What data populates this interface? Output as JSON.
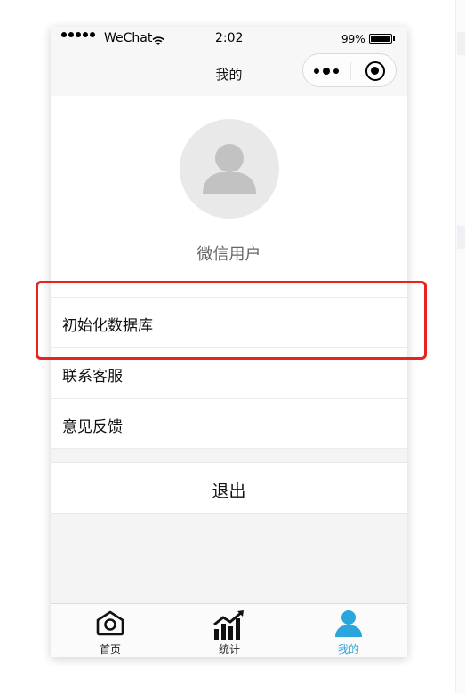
{
  "status_bar": {
    "carrier": "WeChat",
    "time": "2:02",
    "battery_percent": "99%",
    "battery_level": 0.99
  },
  "nav": {
    "title": "我的"
  },
  "profile": {
    "username": "微信用户"
  },
  "menu": {
    "items": [
      {
        "label": "初始化数据库"
      },
      {
        "label": "联系客服"
      },
      {
        "label": "意见反馈"
      }
    ]
  },
  "logout": {
    "label": "退出"
  },
  "tabbar": {
    "items": [
      {
        "label": "首页",
        "icon": "home-icon"
      },
      {
        "label": "统计",
        "icon": "chart-icon"
      },
      {
        "label": "我的",
        "icon": "user-icon",
        "active": true
      }
    ]
  },
  "colors": {
    "active_tab": "#29a6dd",
    "highlight": "#e8221c",
    "background": "#f4f4f5"
  }
}
